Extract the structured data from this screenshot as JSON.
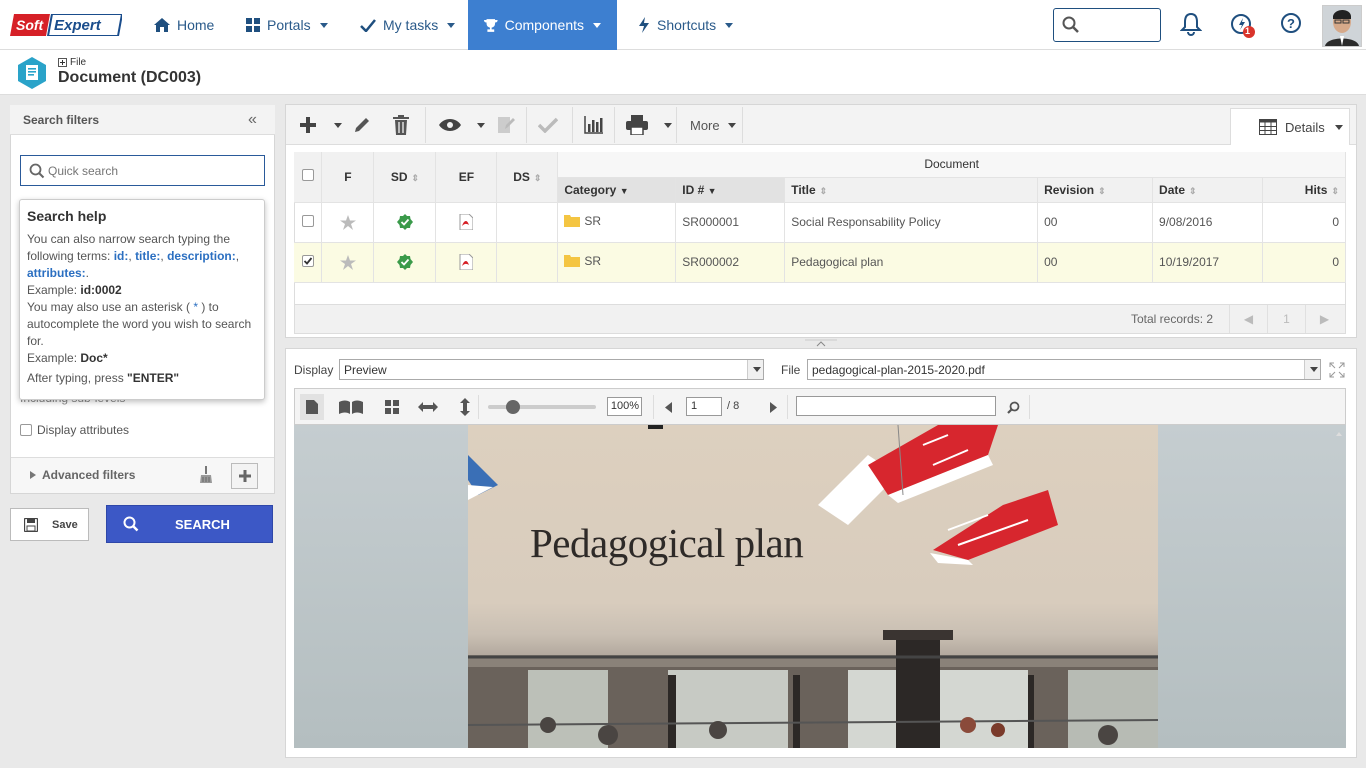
{
  "nav": {
    "logo_text_1": "Soft",
    "logo_text_2": "Expert",
    "items": [
      {
        "label": "Home",
        "icon": "home-icon"
      },
      {
        "label": "Portals",
        "icon": "grid-icon"
      },
      {
        "label": "My tasks",
        "icon": "check-icon"
      },
      {
        "label": "Components",
        "icon": "trophy-icon"
      },
      {
        "label": "Shortcuts",
        "icon": "bolt-icon"
      }
    ],
    "notification_badge": "1",
    "accent": "#3d7fd0"
  },
  "header": {
    "breadcrumb": "File",
    "title": "Document (DC003)"
  },
  "filters": {
    "title": "Search filters",
    "search_placeholder": "Quick search",
    "help_title": "Search help",
    "help_line1": "You can also narrow search typing the following terms:",
    "term_id": "id:",
    "term_title": "title:",
    "term_description": "description:",
    "term_attributes": "attributes:",
    "example_label": "Example:",
    "example_value": "id:0002",
    "help_line2a": "You may also use an asterisk (",
    "asterisk": " * ",
    "help_line2b": ") to autocomplete the word you wish to search for.",
    "example2_value": "Doc*",
    "help_line3a": "After typing, press ",
    "enter": "\"ENTER\"",
    "sublevels": "Including sub-levels",
    "display_attributes": "Display attributes",
    "advanced_filters": "Advanced filters",
    "save": "Save",
    "search": "SEARCH"
  },
  "toolbar": {
    "more": "More",
    "details": "Details"
  },
  "grid": {
    "group_header": "Document",
    "columns": [
      "F",
      "SD",
      "EF",
      "DS",
      "Category",
      "ID #",
      "Title",
      "Revision",
      "Date",
      "Hits"
    ],
    "rows": [
      {
        "category": "SR",
        "id": "SR000001",
        "title": "Social Responsability Policy",
        "revision": "00",
        "date": "9/08/2016",
        "hits": "0",
        "checked": false
      },
      {
        "category": "SR",
        "id": "SR000002",
        "title": "Pedagogical plan",
        "revision": "00",
        "date": "10/19/2017",
        "hits": "0",
        "checked": true
      }
    ],
    "total_records": "Total records: 2",
    "page": "1"
  },
  "preview": {
    "display_label": "Display",
    "display_value": "Preview",
    "file_label": "File",
    "file_value": "pedagogical-plan-2015-2020.pdf",
    "zoom": "100%",
    "page_current": "1",
    "page_total": "/ 8",
    "pdf_title": "Pedagogical plan"
  }
}
